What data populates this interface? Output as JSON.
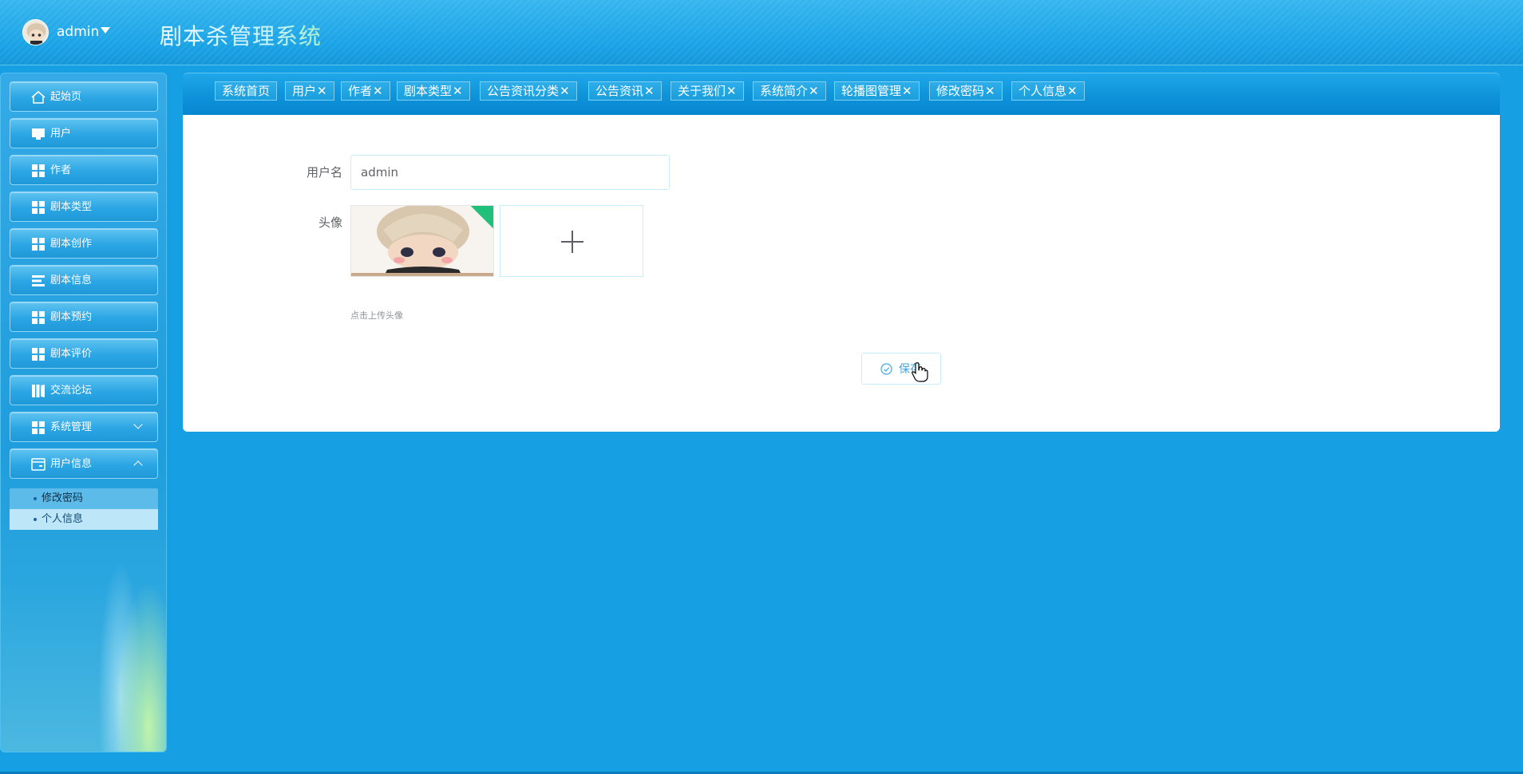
{
  "header": {
    "username": "admin",
    "app_title": "剧本杀管理系统"
  },
  "sidebar": {
    "items": [
      {
        "label": "起始页",
        "icon": "home-icon"
      },
      {
        "label": "用户",
        "icon": "monitor-icon"
      },
      {
        "label": "作者",
        "icon": "grid-icon"
      },
      {
        "label": "剧本类型",
        "icon": "grid-icon"
      },
      {
        "label": "剧本创作",
        "icon": "grid-icon"
      },
      {
        "label": "剧本信息",
        "icon": "list-icon"
      },
      {
        "label": "剧本预约",
        "icon": "grid-icon"
      },
      {
        "label": "剧本评价",
        "icon": "grid-icon"
      },
      {
        "label": "交流论坛",
        "icon": "book-icon"
      },
      {
        "label": "系统管理",
        "icon": "grid-icon"
      },
      {
        "label": "用户信息",
        "icon": "card-icon"
      }
    ],
    "submenu": [
      {
        "label": "修改密码"
      },
      {
        "label": "个人信息",
        "active": true
      }
    ]
  },
  "tabs": [
    {
      "label": "系统首页",
      "closable": false
    },
    {
      "label": "用户",
      "closable": true
    },
    {
      "label": "作者",
      "closable": true
    },
    {
      "label": "剧本类型",
      "closable": true
    },
    {
      "label": "公告资讯分类",
      "closable": true
    },
    {
      "label": "公告资讯",
      "closable": true
    },
    {
      "label": "关于我们",
      "closable": true
    },
    {
      "label": "系统简介",
      "closable": true
    },
    {
      "label": "轮播图管理",
      "closable": true
    },
    {
      "label": "修改密码",
      "closable": true
    },
    {
      "label": "个人信息",
      "closable": true
    }
  ],
  "close_glyph": "✕",
  "form": {
    "username_label": "用户名",
    "username_value": "admin",
    "avatar_label": "头像",
    "upload_tip": "点击上传头像",
    "save_label": "保存"
  },
  "colors": {
    "page_bg": "#169fe3",
    "panel_bg": "#ffffff",
    "accent": "#3fa6e0",
    "upload_success": "#21c07a"
  }
}
